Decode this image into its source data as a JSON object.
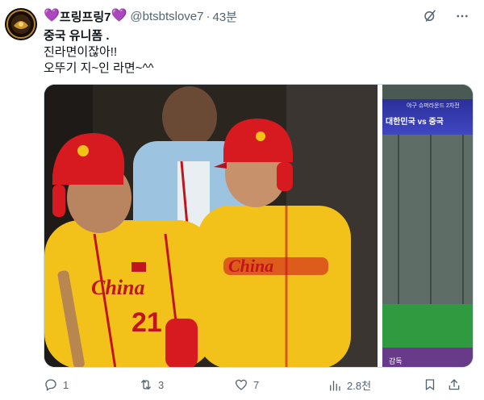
{
  "post": {
    "display_name": "프링프링7",
    "heart_left": "💜",
    "heart_right": "💜",
    "handle": "@btsbtslove7",
    "separator": "·",
    "time": "43분",
    "text_lines": [
      "중국 유니폼 .",
      "진라면이잖아!!",
      "오뚜기 지~인 라면~^^"
    ]
  },
  "media": {
    "side_banner_top": "야구 슈퍼라운드 2차전",
    "side_banner_main": "대한민국 vs 중국",
    "side_caption": "감독",
    "jersey_text": "China",
    "jersey_number": "21",
    "colors": {
      "jersey": "#f2c21a",
      "helmet": "#d71a20",
      "accent": "#c2141d"
    }
  },
  "actions": {
    "replies": "1",
    "retweets": "3",
    "likes": "7",
    "views": "2.8천"
  },
  "icons": {
    "grok": "grok-icon",
    "more": "more-icon",
    "reply": "reply-icon",
    "retweet": "retweet-icon",
    "like": "heart-icon",
    "views": "views-icon",
    "bookmark": "bookmark-icon",
    "share": "share-icon"
  }
}
